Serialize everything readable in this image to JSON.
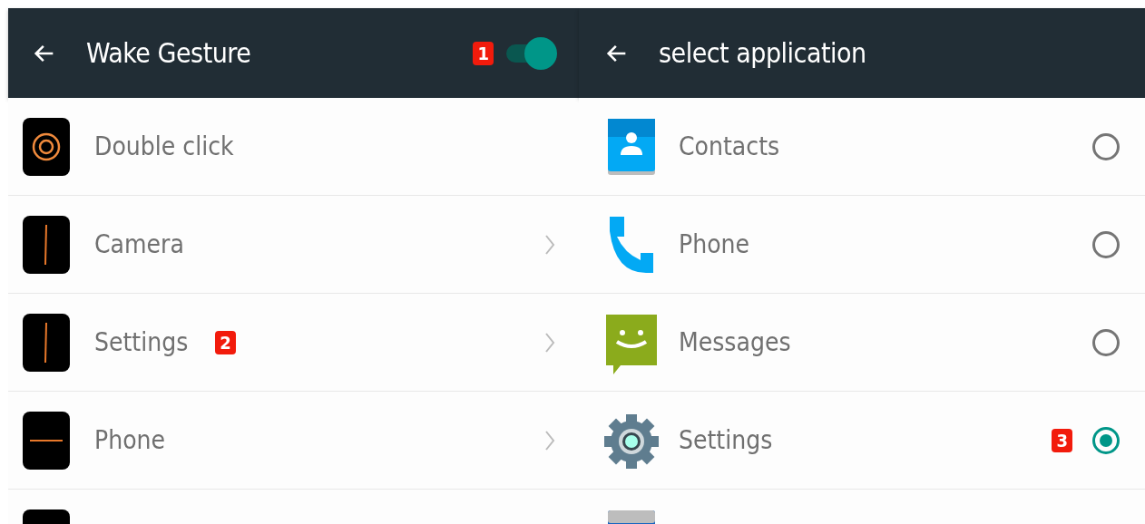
{
  "left_panel": {
    "title": "Wake Gesture",
    "badge": "1",
    "toggle_on": true,
    "items": [
      {
        "label": "Double click",
        "kind": "circle",
        "chevron": false
      },
      {
        "label": "Camera",
        "kind": "vertical",
        "chevron": true
      },
      {
        "label": "Settings",
        "kind": "vertical",
        "chevron": true,
        "badge": "2"
      },
      {
        "label": "Phone",
        "kind": "horizontal",
        "chevron": true
      },
      {
        "kind": "blank"
      }
    ]
  },
  "right_panel": {
    "title": "select application",
    "items": [
      {
        "label": "Contacts",
        "kind": "contacts",
        "selected": false
      },
      {
        "label": "Phone",
        "kind": "phone",
        "selected": false
      },
      {
        "label": "Messages",
        "kind": "messages",
        "selected": false
      },
      {
        "label": "Settings",
        "kind": "settings",
        "selected": true,
        "badge": "3"
      },
      {
        "kind": "calendar"
      }
    ]
  }
}
